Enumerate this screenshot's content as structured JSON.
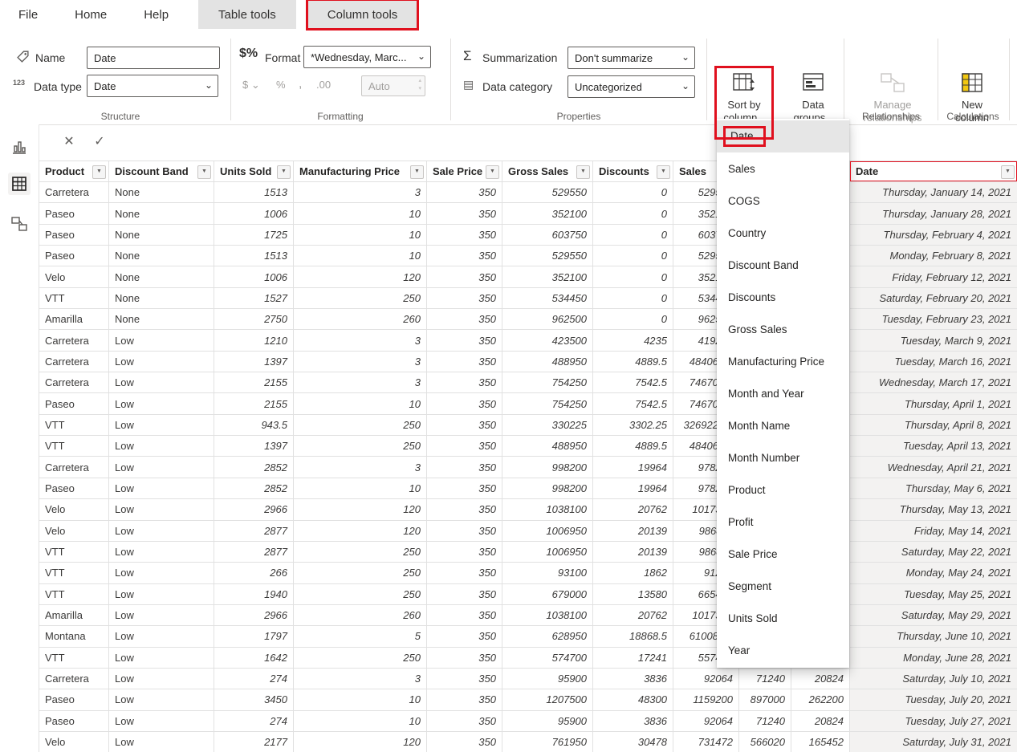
{
  "colors": {
    "annotation_red": "#e0101e",
    "highlight_yellow": "#f2c811",
    "selected_gray": "#e6e6e6",
    "date_col_bg": "#f3f2f1",
    "text_dark": "#252423",
    "text_gray": "#605e5c",
    "disabled": "#a19f9d",
    "grid_line": "#e1e1e1",
    "ctx_tab_bg": "#e3e3e3"
  },
  "icons": {
    "caret_down": "▼",
    "select_caret": "⌄",
    "chevron": "⌄",
    "dismiss": "✕",
    "commit": "✓",
    "sigma": "Σ",
    "format_badge": "$%",
    "datatype_badge": "123",
    "category_badge": "▤",
    "currency": "$ ⌄",
    "percent": "%",
    "thousands": ",",
    "decimals": ".00",
    "spin_up": "▴",
    "spin_down": "▾"
  },
  "menu": {
    "tabs": [
      "File",
      "Home",
      "Help",
      "Table tools",
      "Column tools"
    ]
  },
  "ribbon": {
    "name_label": "Name",
    "name_value": "Date",
    "datatype_label": "Data type",
    "datatype_value": "Date",
    "format_label": "Format",
    "format_value": "*Wednesday, Marc...",
    "auto_label": "Auto",
    "summarization_label": "Summarization",
    "summarization_value": "Don't summarize",
    "category_label": "Data category",
    "category_value": "Uncategorized",
    "sort_by_column_label": "Sort by column",
    "data_groups_label": "Data groups",
    "manage_relationships_label": "Manage relationships",
    "new_column_label": "New column",
    "groups": {
      "structure": "Structure",
      "formatting": "Formatting",
      "properties": "Properties",
      "relationships": "Relationships",
      "calculations": "Calculations"
    }
  },
  "sort_menu": {
    "selected": "Date",
    "items": [
      "Date",
      "Sales",
      "COGS",
      "Country",
      "Discount Band",
      "Discounts",
      "Gross Sales",
      "Manufacturing Price",
      "Month and Year",
      "Month Name",
      "Month Number",
      "Product",
      "Profit",
      "Sale Price",
      "Segment",
      "Units Sold",
      "Year"
    ]
  },
  "table": {
    "columns": [
      "Product",
      "Discount Band",
      "Units Sold",
      "Manufacturing Price",
      "Sale Price",
      "Gross Sales",
      "Discounts",
      "Sales",
      "",
      "",
      "Date"
    ],
    "rows": [
      [
        "Carretera",
        "None",
        "1513",
        "3",
        "350",
        "529550",
        "0",
        "529550",
        "",
        "",
        "Thursday, January 14, 2021"
      ],
      [
        "Paseo",
        "None",
        "1006",
        "10",
        "350",
        "352100",
        "0",
        "352100",
        "",
        "",
        "Thursday, January 28, 2021"
      ],
      [
        "Paseo",
        "None",
        "1725",
        "10",
        "350",
        "603750",
        "0",
        "603750",
        "",
        "",
        "Thursday, February 4, 2021"
      ],
      [
        "Paseo",
        "None",
        "1513",
        "10",
        "350",
        "529550",
        "0",
        "529550",
        "",
        "",
        "Monday, February 8, 2021"
      ],
      [
        "Velo",
        "None",
        "1006",
        "120",
        "350",
        "352100",
        "0",
        "352100",
        "",
        "",
        "Friday, February 12, 2021"
      ],
      [
        "VTT",
        "None",
        "1527",
        "250",
        "350",
        "534450",
        "0",
        "534450",
        "",
        "",
        "Saturday, February 20, 2021"
      ],
      [
        "Amarilla",
        "None",
        "2750",
        "260",
        "350",
        "962500",
        "0",
        "962500",
        "",
        "",
        "Tuesday, February 23, 2021"
      ],
      [
        "Carretera",
        "Low",
        "1210",
        "3",
        "350",
        "423500",
        "4235",
        "419265",
        "",
        "",
        "Tuesday, March 9, 2021"
      ],
      [
        "Carretera",
        "Low",
        "1397",
        "3",
        "350",
        "488950",
        "4889.5",
        "484060.5",
        "",
        "",
        "Tuesday, March 16, 2021"
      ],
      [
        "Carretera",
        "Low",
        "2155",
        "3",
        "350",
        "754250",
        "7542.5",
        "746707.5",
        "",
        "",
        "Wednesday, March 17, 2021"
      ],
      [
        "Paseo",
        "Low",
        "2155",
        "10",
        "350",
        "754250",
        "7542.5",
        "746707.5",
        "",
        "",
        "Thursday, April 1, 2021"
      ],
      [
        "VTT",
        "Low",
        "943.5",
        "250",
        "350",
        "330225",
        "3302.25",
        "326922.75",
        "",
        "",
        "Thursday, April 8, 2021"
      ],
      [
        "VTT",
        "Low",
        "1397",
        "250",
        "350",
        "488950",
        "4889.5",
        "484060.5",
        "",
        "",
        "Tuesday, April 13, 2021"
      ],
      [
        "Carretera",
        "Low",
        "2852",
        "3",
        "350",
        "998200",
        "19964",
        "978236",
        "",
        "",
        "Wednesday, April 21, 2021"
      ],
      [
        "Paseo",
        "Low",
        "2852",
        "10",
        "350",
        "998200",
        "19964",
        "978236",
        "",
        "",
        "Thursday, May 6, 2021"
      ],
      [
        "Velo",
        "Low",
        "2966",
        "120",
        "350",
        "1038100",
        "20762",
        "1017338",
        "",
        "",
        "Thursday, May 13, 2021"
      ],
      [
        "Velo",
        "Low",
        "2877",
        "120",
        "350",
        "1006950",
        "20139",
        "986811",
        "",
        "",
        "Friday, May 14, 2021"
      ],
      [
        "VTT",
        "Low",
        "2877",
        "250",
        "350",
        "1006950",
        "20139",
        "986811",
        "",
        "",
        "Saturday, May 22, 2021"
      ],
      [
        "VTT",
        "Low",
        "266",
        "250",
        "350",
        "93100",
        "1862",
        "91238",
        "",
        "",
        "Monday, May 24, 2021"
      ],
      [
        "VTT",
        "Low",
        "1940",
        "250",
        "350",
        "679000",
        "13580",
        "665420",
        "",
        "",
        "Tuesday, May 25, 2021"
      ],
      [
        "Amarilla",
        "Low",
        "2966",
        "260",
        "350",
        "1038100",
        "20762",
        "1017338",
        "",
        "",
        "Saturday, May 29, 2021"
      ],
      [
        "Montana",
        "Low",
        "1797",
        "5",
        "350",
        "628950",
        "18868.5",
        "610081.5",
        "",
        "",
        "Thursday, June 10, 2021"
      ],
      [
        "VTT",
        "Low",
        "1642",
        "250",
        "350",
        "574700",
        "17241",
        "557459",
        "",
        "",
        "Monday, June 28, 2021"
      ],
      [
        "Carretera",
        "Low",
        "274",
        "3",
        "350",
        "95900",
        "3836",
        "92064",
        "71240",
        "20824",
        "Saturday, July 10, 2021"
      ],
      [
        "Paseo",
        "Low",
        "3450",
        "10",
        "350",
        "1207500",
        "48300",
        "1159200",
        "897000",
        "262200",
        "Tuesday, July 20, 2021"
      ],
      [
        "Paseo",
        "Low",
        "274",
        "10",
        "350",
        "95900",
        "3836",
        "92064",
        "71240",
        "20824",
        "Tuesday, July 27, 2021"
      ],
      [
        "Velo",
        "Low",
        "2177",
        "120",
        "350",
        "761950",
        "30478",
        "731472",
        "566020",
        "165452",
        "Saturday, July 31, 2021"
      ]
    ]
  }
}
